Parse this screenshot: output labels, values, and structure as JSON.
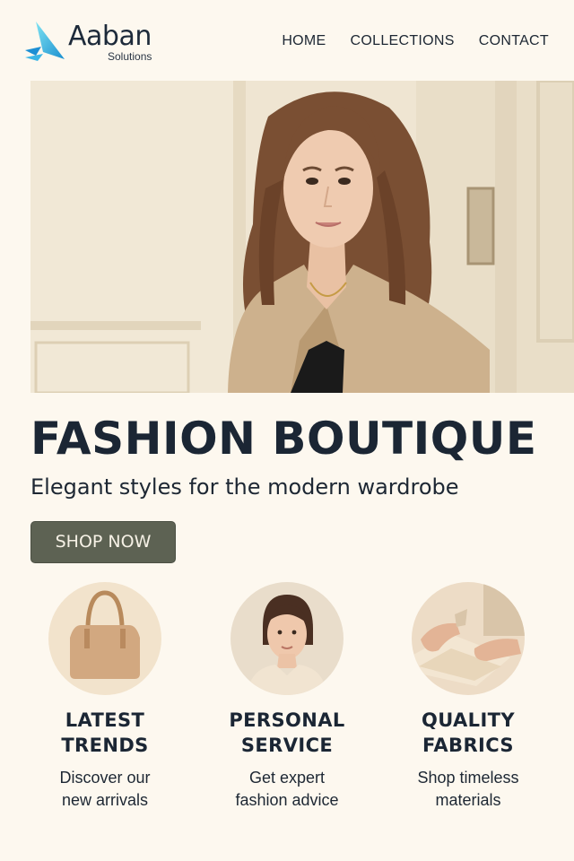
{
  "brand": {
    "name": "Aaban",
    "sub": "Solutions"
  },
  "nav": [
    "HOME",
    "COLLECTIONS",
    "CONTACT"
  ],
  "hero": {
    "title": "FASHION BOUTIQUE",
    "subtitle": "Elegant styles for the modern wardrobe",
    "cta": "SHOP NOW"
  },
  "features": [
    {
      "title_line1": "LATEST",
      "title_line2": "TRENDS",
      "text_line1": "Discover our",
      "text_line2": "new arrivals"
    },
    {
      "title_line1": "PERSONAL",
      "title_line2": "SERVICE",
      "text_line1": "Get expert",
      "text_line2": "fashion advice"
    },
    {
      "title_line1": "QUALITY",
      "title_line2": "FABRICS",
      "text_line1": "Shop timeless",
      "text_line2": "materials"
    }
  ],
  "colors": {
    "background": "#fdf8ef",
    "button": "#5d6253",
    "text": "#1b2634",
    "logo_accent": "#2bb5e0"
  }
}
